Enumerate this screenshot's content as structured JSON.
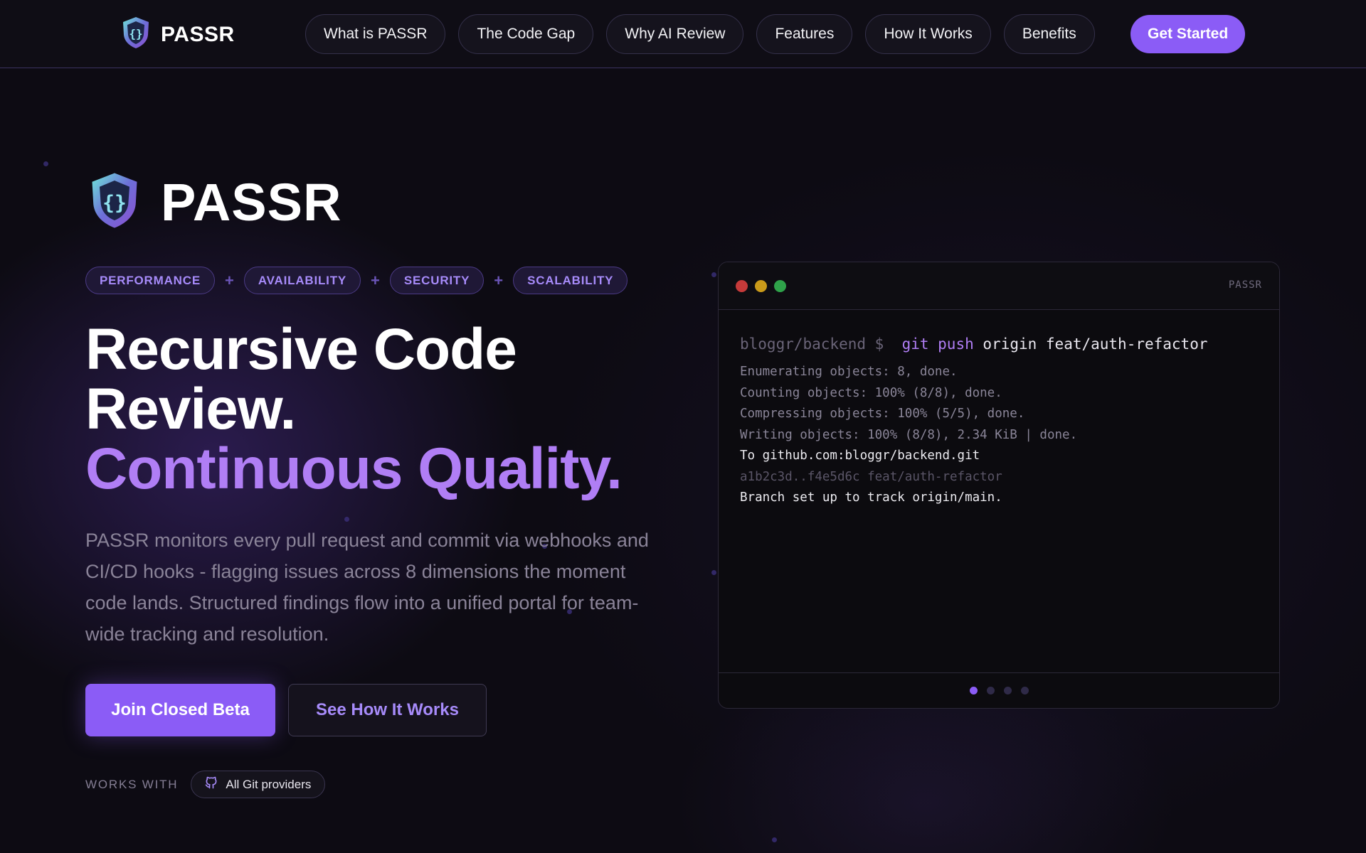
{
  "nav": {
    "brand": "PASSR",
    "links": [
      "What is PASSR",
      "The Code Gap",
      "Why AI Review",
      "Features",
      "How It Works",
      "Benefits"
    ],
    "cta": "Get Started"
  },
  "hero": {
    "brand": "PASSR",
    "tags": [
      "PERFORMANCE",
      "AVAILABILITY",
      "SECURITY",
      "SCALABILITY"
    ],
    "tag_separator": "+",
    "headline_line1": "Recursive Code",
    "headline_line2": "Review.",
    "headline_line3": "Continuous Quality.",
    "description": "PASSR monitors every pull request and commit via webhooks and CI/CD hooks - flagging issues across 8 dimensions the moment code lands. Structured findings flow into a unified portal for team-wide tracking and resolution.",
    "primary_button": "Join Closed Beta",
    "secondary_button": "See How It Works",
    "works_with_label": "WORKS WITH",
    "works_with_value": "All Git providers"
  },
  "terminal": {
    "title": "PASSR",
    "prompt": "bloggr/backend $",
    "command": "git push",
    "command_rest": "origin feat/auth-refactor",
    "output": [
      {
        "text": "Enumerating objects: 8, done.",
        "style": "dim"
      },
      {
        "text": "Counting objects: 100% (8/8), done.",
        "style": "dim"
      },
      {
        "text": "Compressing objects: 100% (5/5), done.",
        "style": "dim"
      },
      {
        "text": "Writing objects: 100% (8/8), 2.34 KiB | done.",
        "style": "dim"
      },
      {
        "text": "To github.com:bloggr/backend.git",
        "style": "bright"
      },
      {
        "text": "a1b2c3d..f4e5d6c feat/auth-refactor",
        "style": "faint"
      },
      {
        "text": "Branch set up to track origin/main.",
        "style": "bright"
      }
    ],
    "pagination_total": 4,
    "pagination_active": 1
  },
  "colors": {
    "accent": "#8b5cf6",
    "accent_light": "#b07ef5",
    "background": "#0d0b13"
  },
  "icons": {
    "brand_logo": "shield-code-icon",
    "works_with": "github-icon"
  }
}
